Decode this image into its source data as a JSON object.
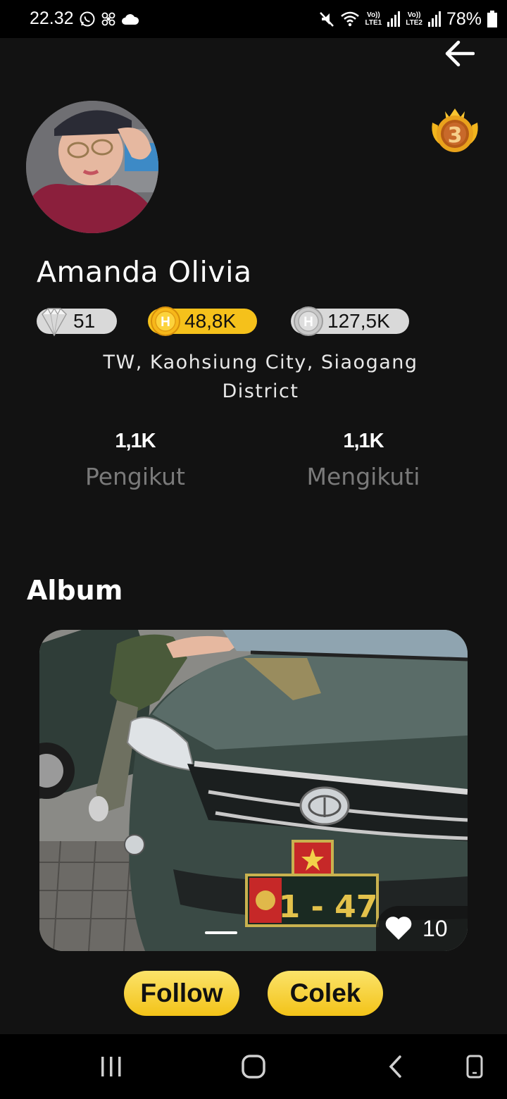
{
  "status_bar": {
    "time": "22.32",
    "net1": "Vo))\nLTE1",
    "net2": "Vo))\nLTE2",
    "battery": "78%",
    "icons": [
      "whatsapp-icon",
      "fan-icon",
      "cloud-icon",
      "mute-icon",
      "wifi-icon",
      "signal-icon",
      "battery-icon"
    ]
  },
  "profile": {
    "name": "Amanda Olivia",
    "rank_badge": "3",
    "diamonds": "51",
    "gold_coins": "48,8K",
    "silver_coins": "127,5K",
    "location": "TW, Kaohsiung City, Siaogang District",
    "followers": {
      "value": "1,1K",
      "label": "Pengikut"
    },
    "following": {
      "value": "1,1K",
      "label": "Mengikuti"
    }
  },
  "album": {
    "title": "Album",
    "likes": "10"
  },
  "actions": {
    "follow_label": "Follow",
    "colek_label": "Colek"
  },
  "colors": {
    "background": "#121212",
    "accent_gold": "#f5c11b",
    "pill_gray": "#d9d9d9",
    "muted_text": "#7a7a7a"
  }
}
